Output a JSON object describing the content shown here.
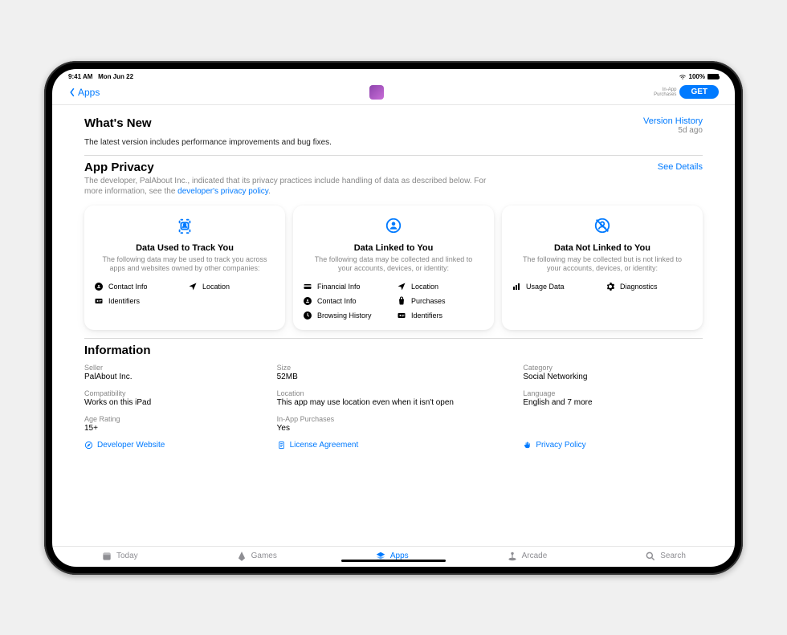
{
  "status": {
    "time": "9:41 AM",
    "date": "Mon Jun 22",
    "battery": "100%"
  },
  "nav": {
    "back": "Apps",
    "iap": "In-App\nPurchases",
    "get": "GET"
  },
  "whatsNew": {
    "title": "What's New",
    "history": "Version History",
    "age": "5d ago",
    "body": "The latest version includes performance improvements and bug fixes."
  },
  "appPrivacy": {
    "title": "App Privacy",
    "seeDetails": "See Details",
    "desc1": "The developer, PalAbout Inc., indicated that its privacy practices include handling of data as described below. For more information, see the ",
    "policyLink": "developer's privacy policy",
    "cards": [
      {
        "title": "Data Used to Track You",
        "sub": "The following data may be used to track you across apps and websites owned by other companies:",
        "items": [
          {
            "icon": "contact",
            "label": "Contact Info"
          },
          {
            "icon": "location",
            "label": "Location"
          },
          {
            "icon": "id",
            "label": "Identifiers"
          }
        ]
      },
      {
        "title": "Data Linked to You",
        "sub": "The following data may be collected and linked to your accounts, devices, or identity:",
        "items": [
          {
            "icon": "financial",
            "label": "Financial Info"
          },
          {
            "icon": "location",
            "label": "Location"
          },
          {
            "icon": "contact",
            "label": "Contact Info"
          },
          {
            "icon": "purchase",
            "label": "Purchases"
          },
          {
            "icon": "history",
            "label": "Browsing History"
          },
          {
            "icon": "id",
            "label": "Identifiers"
          }
        ]
      },
      {
        "title": "Data Not Linked to You",
        "sub": "The following may be collected but is not linked to your accounts, devices, or identity:",
        "items": [
          {
            "icon": "usage",
            "label": "Usage Data"
          },
          {
            "icon": "diag",
            "label": "Diagnostics"
          }
        ]
      }
    ]
  },
  "information": {
    "title": "Information",
    "rows": [
      [
        {
          "label": "Seller",
          "value": "PalAbout Inc."
        },
        {
          "label": "Size",
          "value": "52MB"
        },
        {
          "label": "Category",
          "value": "Social Networking"
        }
      ],
      [
        {
          "label": "Compatibility",
          "value": "Works on this iPad"
        },
        {
          "label": "Location",
          "value": "This app may use location even when it isn't open"
        },
        {
          "label": "Language",
          "value": "English and 7 more"
        }
      ],
      [
        {
          "label": "Age Rating",
          "value": "15+"
        },
        {
          "label": "In-App Purchases",
          "value": "Yes"
        }
      ]
    ],
    "links": {
      "dev": "Developer Website",
      "license": "License Agreement",
      "privacy": "Privacy Policy"
    }
  },
  "tabs": {
    "today": "Today",
    "games": "Games",
    "apps": "Apps",
    "arcade": "Arcade",
    "search": "Search"
  }
}
